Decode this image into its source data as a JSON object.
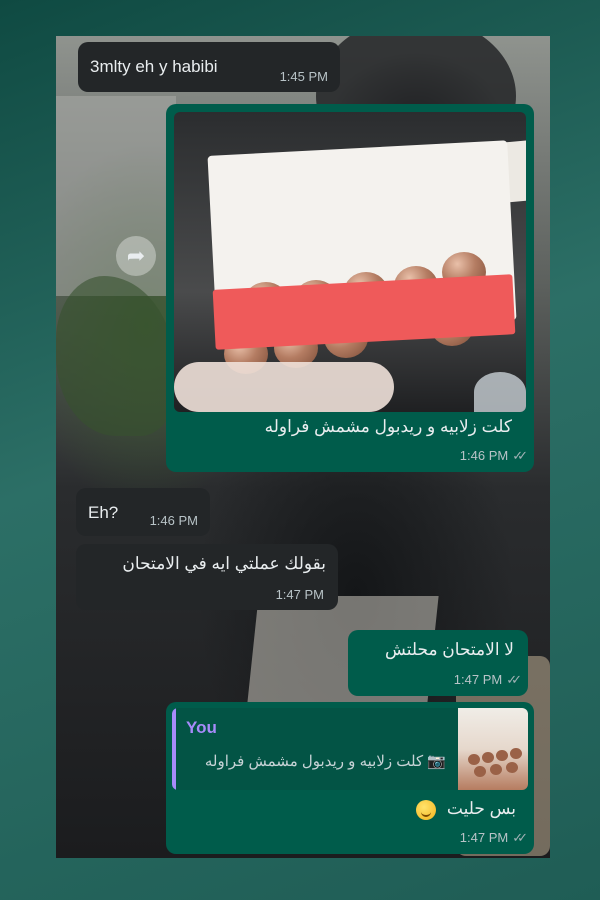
{
  "messages": [
    {
      "id": "m1",
      "text": "3mlty eh y habibi",
      "time": "1:45 PM"
    },
    {
      "id": "m2",
      "caption": "كلت زلابيه و ريدبول مشمش فراوله",
      "time": "1:46 PM"
    },
    {
      "id": "m3",
      "text": "Eh?",
      "time": "1:46 PM"
    },
    {
      "id": "m4",
      "text": "بقولك عملتي ايه في الامتحان",
      "time": "1:47 PM"
    },
    {
      "id": "m5",
      "text": "لا الامتحان محلتش",
      "time": "1:47 PM"
    },
    {
      "id": "m6",
      "quote_sender": "You",
      "quote_text": "كلت زلابيه و ريدبول مشمش فراوله",
      "text": "بس حليت",
      "time": "1:47 PM"
    }
  ],
  "icons": {
    "forward": "forward-arrow-icon",
    "camera": "camera-icon",
    "read_receipt": "double-check-icon",
    "emoji": "smiling-face-emoji"
  },
  "colors": {
    "incoming": "#232628",
    "outgoing": "#005c4b",
    "quote_accent": "#a78bfa"
  }
}
